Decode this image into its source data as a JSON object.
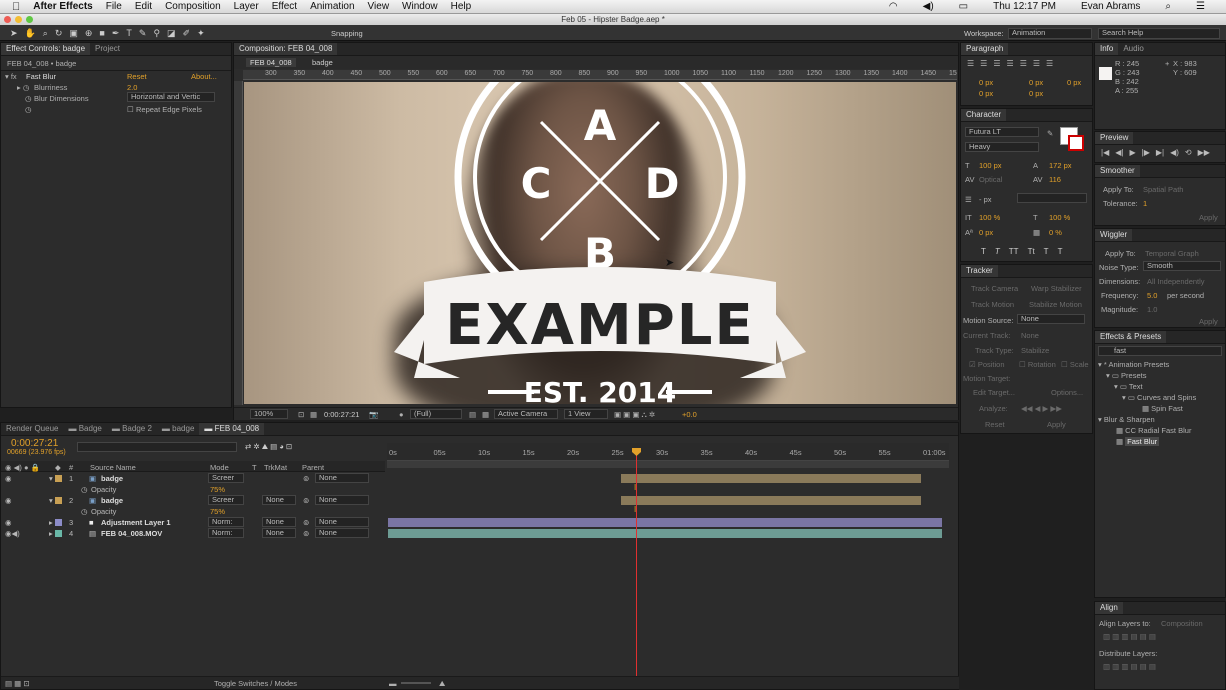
{
  "menubar": {
    "apple": "",
    "app": "After Effects",
    "items": [
      "File",
      "Edit",
      "Composition",
      "Layer",
      "Effect",
      "Animation",
      "View",
      "Window",
      "Help"
    ],
    "clock": "Thu 12:17 PM",
    "user": "Evan Abrams"
  },
  "window_title": "Feb 05 - Hipster Badge.aep *",
  "toolbar": {
    "snapping": "Snapping",
    "workspace_label": "Workspace:",
    "workspace": "Animation",
    "search_help": "Search Help"
  },
  "effect_controls": {
    "tab": "Effect Controls: badge",
    "tab2": "Project",
    "breadcrumb": "FEB 04_008 • badge",
    "effect_name": "Fast Blur",
    "reset": "Reset",
    "about": "About...",
    "props": [
      {
        "name": "Blurriness",
        "value": "2.0"
      },
      {
        "name": "Blur Dimensions",
        "value": "Horizontal and Vertic"
      }
    ],
    "checkbox_label": "Repeat Edge Pixels"
  },
  "composition": {
    "tab": "Composition: FEB 04_008",
    "crumb1": "FEB 04_008",
    "crumb2": "badge",
    "ruler": [
      "300",
      "350",
      "400",
      "450",
      "500",
      "550",
      "600",
      "650",
      "700",
      "750",
      "800",
      "850",
      "900",
      "950",
      "1000",
      "1050",
      "1100",
      "1150",
      "1200",
      "1250",
      "1300",
      "1350",
      "1400",
      "1450",
      "1500"
    ],
    "badge": {
      "letters": [
        "A",
        "C",
        "D",
        "B"
      ],
      "banner": "EXAMPLE",
      "est": "EST. 2014"
    },
    "zoom": "100%",
    "timecode": "0:00:27:21",
    "resolution": "(Full)",
    "camera": "Active Camera",
    "view": "1 View",
    "exposure": "+0.0"
  },
  "paragraph": {
    "tab": "Paragraph",
    "fields": [
      "0 px",
      "0 px",
      "0 px",
      "0 px",
      "0 px"
    ]
  },
  "character": {
    "tab": "Character",
    "font": "Futura LT",
    "style": "Heavy",
    "size": "100 px",
    "leading": "172 px",
    "kerning": "Optical",
    "tracking": "116",
    "stroke": "- px",
    "vscale": "100 %",
    "hscale": "100 %",
    "baseline": "0 px",
    "tsume": "0 %",
    "styles": [
      "T",
      "T",
      "TT",
      "Tt",
      "T",
      "T"
    ]
  },
  "tracker": {
    "tab": "Tracker",
    "buttons": [
      "Track Camera",
      "Warp Stabilizer",
      "Track Motion",
      "Stabilize Motion"
    ],
    "motion_source_label": "Motion Source:",
    "motion_source": "None",
    "current_track_label": "Current Track:",
    "current_track": "None",
    "track_type_label": "Track Type:",
    "track_type": "Stabilize",
    "checks": [
      "Position",
      "Rotation",
      "Scale"
    ],
    "motion_target_label": "Motion Target:",
    "edit_target": "Edit Target...",
    "options": "Options...",
    "analyze_label": "Analyze:",
    "reset": "Reset",
    "apply": "Apply"
  },
  "info": {
    "tab": "Info",
    "tab2": "Audio",
    "r": "R : 245",
    "g": "G : 243",
    "b": "B : 242",
    "a": "A : 255",
    "x": "X : 983",
    "y": "Y : 609"
  },
  "preview": {
    "tab": "Preview"
  },
  "smoother": {
    "tab": "Smoother",
    "apply_to_label": "Apply To:",
    "apply_to": "Spatial Path",
    "tolerance_label": "Tolerance:",
    "tolerance": "1",
    "apply": "Apply"
  },
  "wiggler": {
    "tab": "Wiggler",
    "apply_to_label": "Apply To:",
    "apply_to": "Temporal Graph",
    "noise_label": "Noise Type:",
    "noise": "Smooth",
    "dimensions_label": "Dimensions:",
    "dimensions": "All Independently",
    "frequency_label": "Frequency:",
    "frequency": "5.0",
    "per_second": "per second",
    "magnitude_label": "Magnitude:",
    "magnitude": "1.0",
    "apply": "Apply"
  },
  "effects_presets": {
    "tab": "Effects & Presets",
    "search": "fast",
    "tree": [
      {
        "label": "* Animation Presets",
        "indent": 0
      },
      {
        "label": "Presets",
        "indent": 1
      },
      {
        "label": "Text",
        "indent": 2
      },
      {
        "label": "Curves and Spins",
        "indent": 3
      },
      {
        "label": "Spin Fast",
        "indent": 4
      },
      {
        "label": "Blur & Sharpen",
        "indent": 0
      },
      {
        "label": "CC Radial Fast Blur",
        "indent": 1
      },
      {
        "label": "Fast Blur",
        "indent": 1
      }
    ]
  },
  "align": {
    "tab": "Align",
    "align_to_label": "Align Layers to:",
    "align_to": "Composition",
    "distribute": "Distribute Layers:"
  },
  "timeline": {
    "tabs": [
      "Render Queue",
      "Badge",
      "Badge 2",
      "badge",
      "FEB 04_008"
    ],
    "timecode": "0:00:27:21",
    "frames": "00669 (23.976 fps)",
    "columns": {
      "hash": "#",
      "source": "Source Name",
      "mode": "Mode",
      "t": "T",
      "trkmat": "TrkMat",
      "parent": "Parent"
    },
    "ticks": [
      "0s",
      "05s",
      "10s",
      "15s",
      "20s",
      "25s",
      "30s",
      "35s",
      "40s",
      "45s",
      "50s",
      "55s",
      "01:00s"
    ],
    "layers": [
      {
        "num": "1",
        "name": "badge",
        "mode": "Screer",
        "trkmat": "",
        "parent": "None",
        "opacity_label": "Opacity",
        "opacity": "75%"
      },
      {
        "num": "2",
        "name": "badge",
        "mode": "Screer",
        "trkmat": "None",
        "parent": "None",
        "opacity_label": "Opacity",
        "opacity": "75%"
      },
      {
        "num": "3",
        "name": "Adjustment Layer 1",
        "mode": "Norm:",
        "trkmat": "None",
        "parent": "None"
      },
      {
        "num": "4",
        "name": "FEB 04_008.MOV",
        "mode": "Norm:",
        "trkmat": "None",
        "parent": "None"
      }
    ],
    "toggle_label": "Toggle Switches / Modes"
  }
}
